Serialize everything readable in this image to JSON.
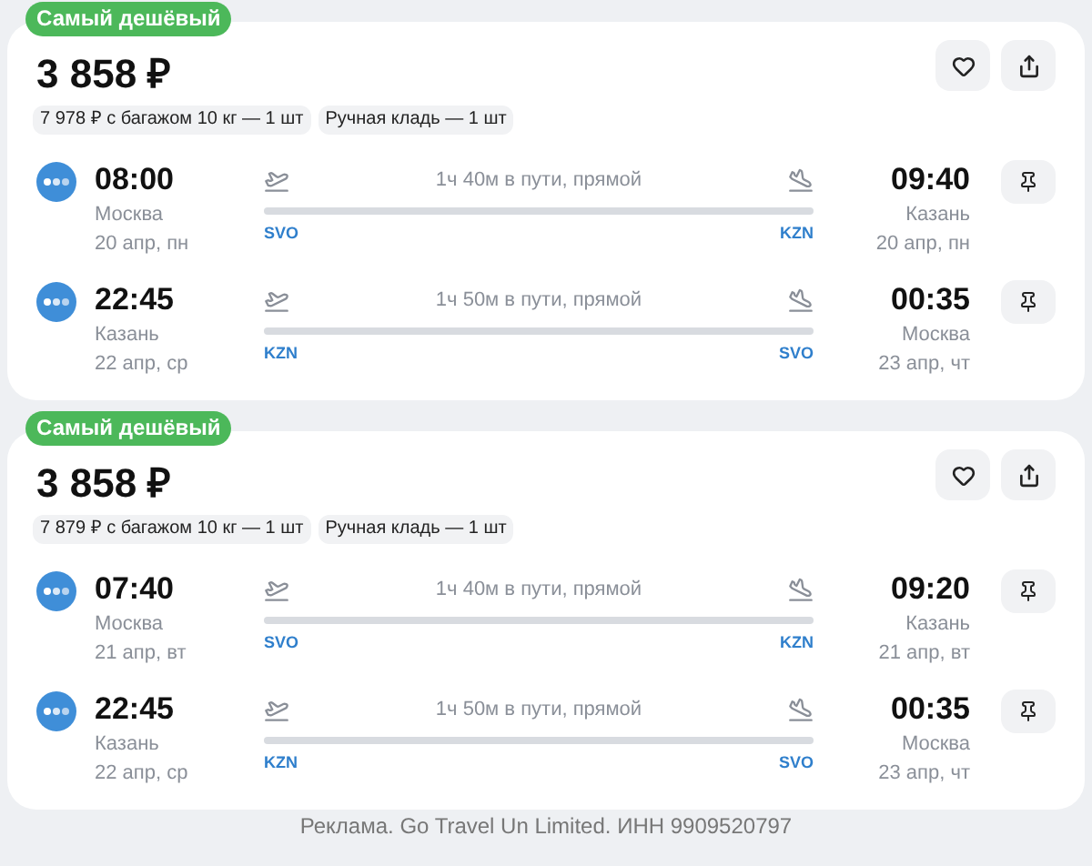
{
  "offers": [
    {
      "badge": "Самый дешёвый",
      "price": "3 858 ₽",
      "tags": [
        "7 978 ₽ с багажом 10 кг — 1 шт",
        "Ручная кладь — 1 шт"
      ],
      "segments": [
        {
          "dep_time": "08:00",
          "dep_city": "Москва",
          "dep_date": "20 апр, пн",
          "duration": "1ч 40м в пути, прямой",
          "from": "SVO",
          "to": "KZN",
          "arr_time": "09:40",
          "arr_city": "Казань",
          "arr_date": "20 апр, пн"
        },
        {
          "dep_time": "22:45",
          "dep_city": "Казань",
          "dep_date": "22 апр, ср",
          "duration": "1ч 50м в пути, прямой",
          "from": "KZN",
          "to": "SVO",
          "arr_time": "00:35",
          "arr_city": "Москва",
          "arr_date": "23 апр, чт"
        }
      ]
    },
    {
      "badge": "Самый дешёвый",
      "price": "3 858 ₽",
      "tags": [
        "7 879 ₽ с багажом 10 кг — 1 шт",
        "Ручная кладь — 1 шт"
      ],
      "segments": [
        {
          "dep_time": "07:40",
          "dep_city": "Москва",
          "dep_date": "21 апр, вт",
          "duration": "1ч 40м в пути, прямой",
          "from": "SVO",
          "to": "KZN",
          "arr_time": "09:20",
          "arr_city": "Казань",
          "arr_date": "21 апр, вт"
        },
        {
          "dep_time": "22:45",
          "dep_city": "Казань",
          "dep_date": "22 апр, ср",
          "duration": "1ч 50м в пути, прямой",
          "from": "KZN",
          "to": "SVO",
          "arr_time": "00:35",
          "arr_city": "Москва",
          "arr_date": "23 апр, чт"
        }
      ]
    }
  ],
  "footer": "Реклама. Go Travel Un Limited. ИНН 9909520797"
}
